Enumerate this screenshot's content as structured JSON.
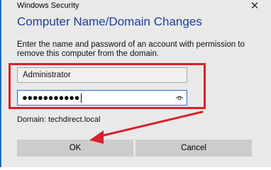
{
  "window": {
    "title": "Windows Security",
    "close_icon": "close-icon"
  },
  "dialog": {
    "heading": "Computer Name/Domain Changes",
    "description": "Enter the name and password of an account with permission to remove this computer from the domain."
  },
  "username": {
    "value": "Administrator"
  },
  "password": {
    "masked_value": "●●●●●●●●●●●",
    "reveal_icon": "eye-icon"
  },
  "domain": {
    "label": "Domain: techdirect.local"
  },
  "buttons": {
    "ok_label": "OK",
    "cancel_label": "Cancel"
  },
  "annotation": {
    "color": "#d9202a"
  }
}
